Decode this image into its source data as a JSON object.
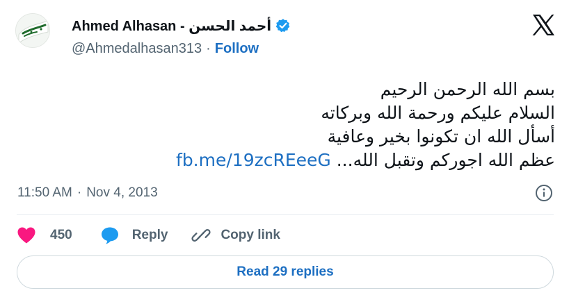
{
  "author": {
    "display_name": "Ahmed Alhasan - أحمد الحسن",
    "handle": "@Ahmedalhasan313",
    "separator": "·",
    "follow_label": "Follow",
    "avatar_text": "البيعة لله",
    "verified_icon": "verified-badge-icon",
    "brand_icon": "x-logo-icon"
  },
  "tweet": {
    "lines": [
      "بسم الله الرحمن الرحيم",
      "السلام عليكم ورحمة الله وبركاته",
      "أسأل الله ان تكونوا بخير وعافية"
    ],
    "last_line_text": "عظم الله اجوركم وتقبل الله...",
    "link_text": "fb.me/19zcREeeG"
  },
  "meta": {
    "time": "11:50 AM",
    "separator": "·",
    "date": "Nov 4, 2013",
    "info_icon": "info-icon"
  },
  "actions": {
    "like_count": "450",
    "reply_label": "Reply",
    "copy_label": "Copy link"
  },
  "footer": {
    "read_replies_label": "Read 29 replies"
  },
  "colors": {
    "accent": "#1d6fc2",
    "secondary_text": "#536471",
    "heart": "#f91880",
    "reply_bubble": "#1d9bf0",
    "verified": "#1d9bf0"
  }
}
